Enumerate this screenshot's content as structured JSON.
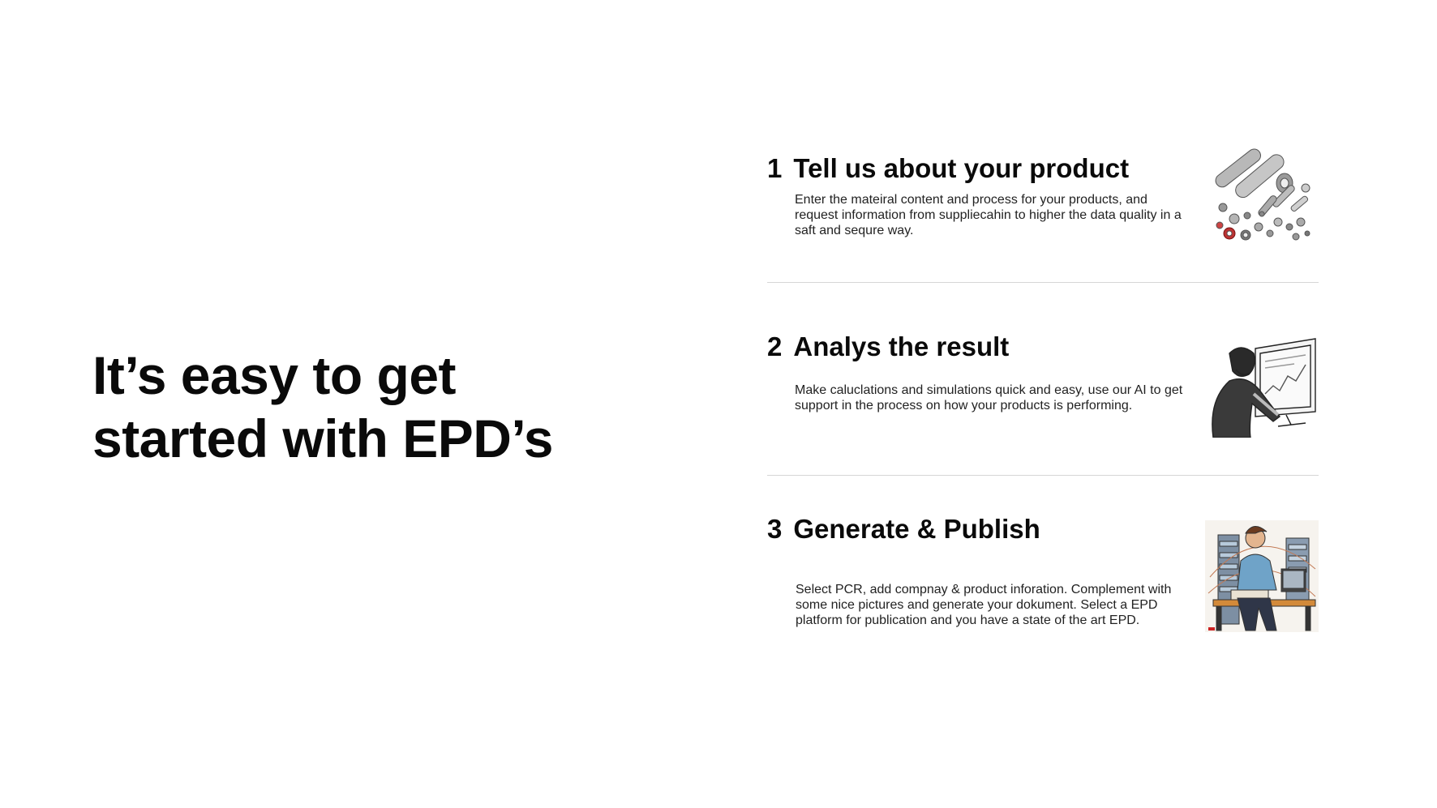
{
  "hero": {
    "line1": "It’s easy to get",
    "line2": "started with EPD’s"
  },
  "steps": [
    {
      "number": "1",
      "title": "Tell us about your product",
      "description": "Enter the mateiral content and process for your products, and request information from suppliecahin to higher the data quality in a saft and sequre way.",
      "illustration": "metal-parts-icon"
    },
    {
      "number": "2",
      "title": "Analys the result",
      "description": "Make caluclations and simulations quick and easy, use our AI to get support in the process on how your products is performing.",
      "illustration": "analyst-at-monitor-icon"
    },
    {
      "number": "3",
      "title": "Generate & Publish",
      "description": "Select PCR, add compnay & product inforation. Complement with some nice pictures and generate your dokument. Select a EPD platform for publication and you have a state of the art EPD.",
      "illustration": "person-at-desk-icon"
    }
  ],
  "colors": {
    "text": "#0a0a0a",
    "body_text": "#222222",
    "divider": "#d6d6d6",
    "background": "#ffffff"
  }
}
